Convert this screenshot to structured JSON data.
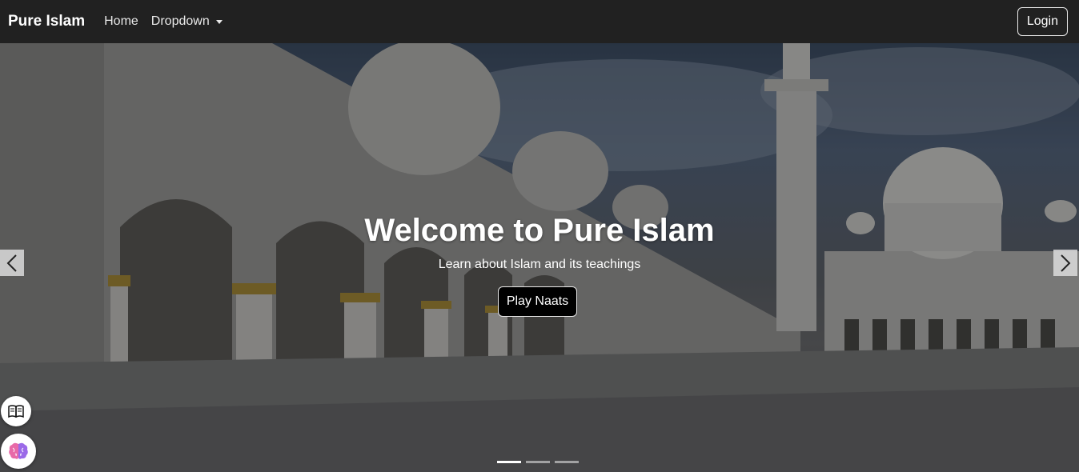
{
  "navbar": {
    "brand": "Pure Islam",
    "links": [
      {
        "label": "Home"
      },
      {
        "label": "Dropdown"
      }
    ],
    "login_label": "Login"
  },
  "hero": {
    "title": "Welcome to Pure Islam",
    "subtitle": "Learn about Islam and its teachings",
    "cta_label": "Play Naats",
    "slides_count": 3,
    "active_slide": 1
  },
  "floating": {
    "icons": [
      "book-icon",
      "brain-icon"
    ]
  },
  "colors": {
    "navbar_bg": "#212121",
    "button_bg": "#000000",
    "text": "#ffffff"
  }
}
